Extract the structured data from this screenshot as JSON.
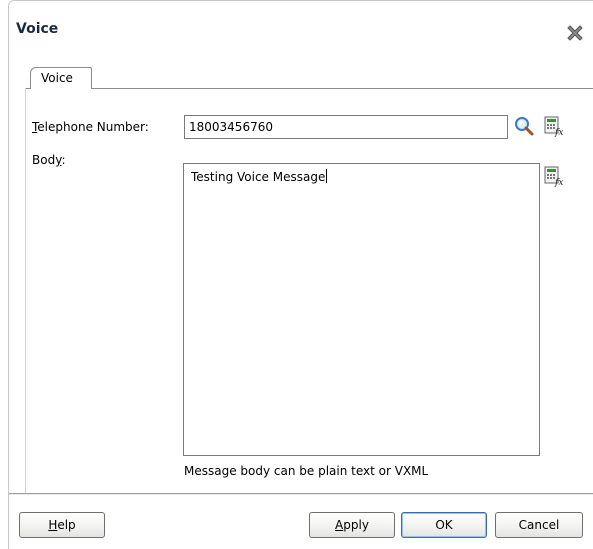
{
  "dialog": {
    "title": "Voice",
    "tab_label": "Voice"
  },
  "form": {
    "telephone_label_prefix": "T",
    "telephone_label_rest": "elephone Number:",
    "telephone_value": "18003456760",
    "body_label_prefix": "Bod",
    "body_label_mnemonic": "y",
    "body_label_suffix": ":",
    "body_value": "Testing Voice Message",
    "hint": "Message body can be plain text or VXML"
  },
  "buttons": {
    "help_mnemonic": "H",
    "help_rest": "elp",
    "apply_mnemonic": "A",
    "apply_rest": "pply",
    "ok": "OK",
    "cancel": "Cancel"
  },
  "icons": {
    "close": "close-icon",
    "search": "search-icon",
    "expression_builder": "expression-builder-icon"
  }
}
